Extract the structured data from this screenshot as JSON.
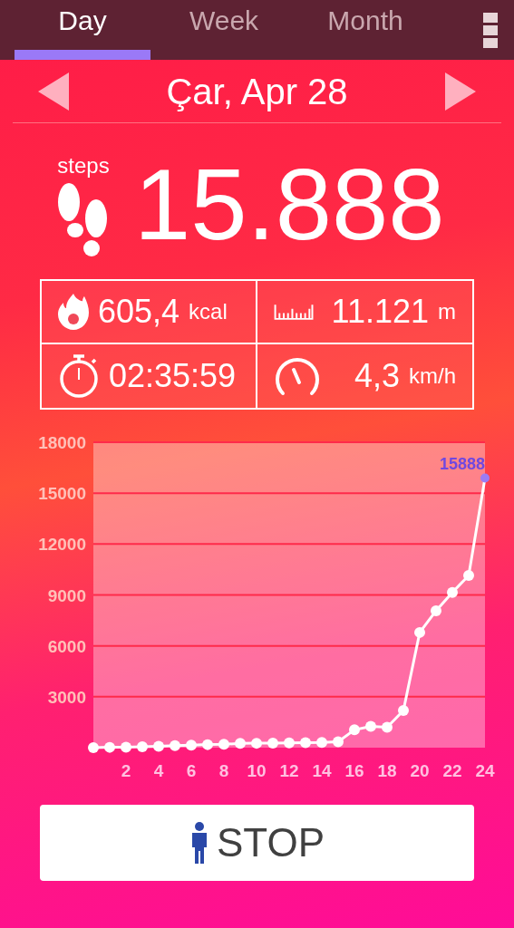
{
  "tabs": [
    {
      "label": "Day",
      "selected": true
    },
    {
      "label": "Week",
      "selected": false
    },
    {
      "label": "Month",
      "selected": false
    }
  ],
  "date": "Çar, Apr 28",
  "steps": {
    "label": "steps",
    "value": "15.888"
  },
  "stats": [
    {
      "kind": "calories",
      "value": "605,4",
      "unit": "kcal"
    },
    {
      "kind": "distance",
      "value": "11.121",
      "unit": "m"
    },
    {
      "kind": "duration",
      "value": "02:35:59"
    },
    {
      "kind": "speed",
      "value": "4,3",
      "unit": "km/h"
    }
  ],
  "chart_data": {
    "type": "line",
    "x": [
      0,
      1,
      2,
      3,
      4,
      5,
      6,
      7,
      8,
      9,
      10,
      11,
      12,
      13,
      14,
      15,
      16,
      17,
      18,
      19,
      20,
      21,
      22,
      23,
      24
    ],
    "grid": true,
    "series": [
      {
        "color": "#ffffff",
        "marker": "circle",
        "values": [
          0,
          20,
          30,
          50,
          80,
          120,
          150,
          180,
          200,
          250,
          260,
          270,
          280,
          300,
          310,
          350,
          1050,
          1250,
          1200,
          2190,
          6790,
          8070,
          9150,
          10150,
          15888
        ]
      }
    ],
    "xlim": [
      0,
      24
    ],
    "ylim": [
      0,
      18000
    ],
    "xticks": [
      2,
      4,
      6,
      8,
      10,
      12,
      14,
      16,
      18,
      20,
      22,
      24
    ],
    "yticks": [
      3000,
      6000,
      9000,
      12000,
      15000,
      18000
    ],
    "annotations": [
      {
        "x": 24,
        "y": 15888,
        "text": "15888"
      }
    ]
  },
  "stop_button": "STOP"
}
